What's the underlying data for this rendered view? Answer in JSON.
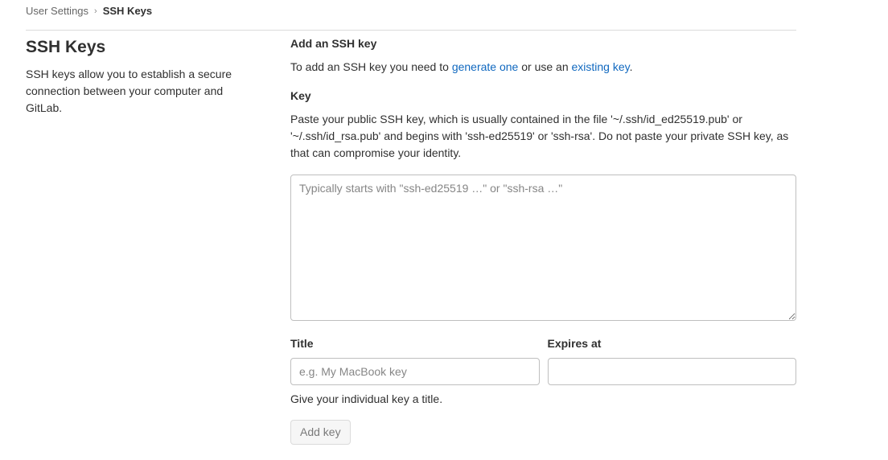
{
  "breadcrumb": {
    "parent": "User Settings",
    "separator": "›",
    "current": "SSH Keys"
  },
  "sidebar": {
    "title": "SSH Keys",
    "description": "SSH keys allow you to establish a secure connection between your computer and GitLab."
  },
  "form": {
    "heading": "Add an SSH key",
    "intro_prefix": "To add an SSH key you need to ",
    "generate_link": "generate one",
    "intro_middle": " or use an ",
    "existing_link": "existing key",
    "intro_suffix": ".",
    "key_label": "Key",
    "key_help": "Paste your public SSH key, which is usually contained in the file '~/.ssh/id_ed25519.pub' or '~/.ssh/id_rsa.pub' and begins with 'ssh-ed25519' or 'ssh-rsa'. Do not paste your private SSH key, as that can compromise your identity.",
    "key_placeholder": "Typically starts with \"ssh-ed25519 …\" or \"ssh-rsa …\"",
    "key_value": "",
    "title_label": "Title",
    "title_placeholder": "e.g. My MacBook key",
    "title_value": "",
    "title_help": "Give your individual key a title.",
    "expires_label": "Expires at",
    "expires_value": "",
    "submit_label": "Add key"
  },
  "colors": {
    "link": "#1068bf",
    "text": "#303030",
    "border": "#bfbfbf",
    "disabled_button_bg": "#f6f6f6"
  }
}
